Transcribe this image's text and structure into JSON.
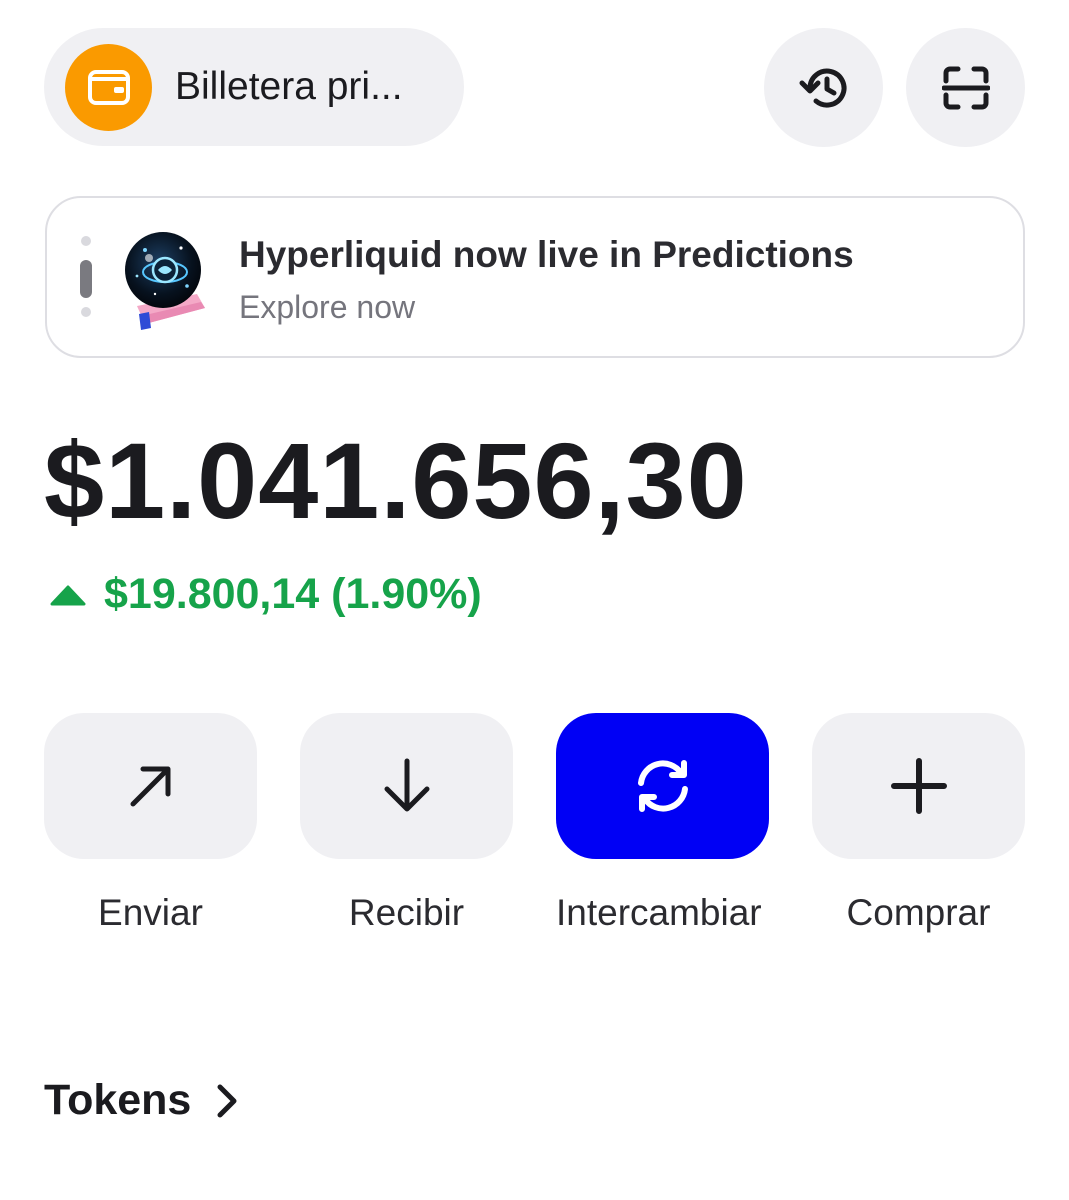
{
  "header": {
    "wallet_name": "Billetera pri...",
    "wallet_color": "#fa9a00",
    "wallet_icon": "wallet-icon",
    "history_icon": "history-icon",
    "scan_icon": "scan-icon"
  },
  "banner": {
    "title": "Hyperliquid now live in Predictions",
    "subtitle": "Explore now",
    "image": "crystal-ball-illustration",
    "pager": {
      "count": 3,
      "active": 2
    }
  },
  "portfolio": {
    "balance": "$1.041.656,30",
    "change": "$19.800,14 (1.90%)",
    "change_direction": "up",
    "change_color": "#16a34a"
  },
  "actions": [
    {
      "label": "Enviar",
      "icon": "arrow-up-right-icon"
    },
    {
      "label": "Recibir",
      "icon": "arrow-down-icon"
    },
    {
      "label": "Intercambiar",
      "icon": "swap-icon",
      "highlight_color": "#0000f5"
    },
    {
      "label": "Comprar",
      "icon": "plus-icon"
    }
  ],
  "tokens": {
    "title": "Tokens",
    "icon": "chevron-right-icon"
  }
}
